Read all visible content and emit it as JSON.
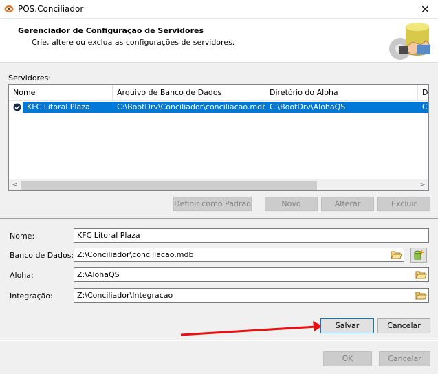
{
  "window": {
    "title": "POS.Conciliador",
    "close_glyph": "✕"
  },
  "header": {
    "title": "Gerenciador de Configuração de Servidores",
    "subtitle": "Crie, altere ou exclua as configurações de servidores.",
    "icon": "handshake-database-gear-icon"
  },
  "servers": {
    "label": "Servidores:",
    "columns": [
      "Nome",
      "Arquivo de Banco de Dados",
      "Diretório do Aloha",
      "Di"
    ],
    "rows": [
      {
        "cells": [
          "KFC Litoral Plaza",
          "C:\\BootDrv\\Conciliador\\conciliacao.mdb",
          "C:\\BootDrv\\AlohaQS",
          "C:"
        ],
        "selected": true,
        "default": true
      }
    ],
    "scroll_left": "<",
    "scroll_right": ">"
  },
  "list_buttons": {
    "set_default": "Definir como Padrão",
    "new": "Novo",
    "edit": "Alterar",
    "delete": "Excluir"
  },
  "form": {
    "name_label": "Nome:",
    "name_value": "KFC Litoral Plaza",
    "db_label": "Banco de Dados:",
    "db_value": "Z:\\Conciliador\\conciliacao.mdb",
    "aloha_label": "Aloha:",
    "aloha_value": "Z:\\AlohaQS",
    "integration_label": "Integração:",
    "integration_value": "Z:\\Conciliador\\Integracao"
  },
  "form_buttons": {
    "save": "Salvar",
    "cancel": "Cancelar"
  },
  "dialog_buttons": {
    "ok": "OK",
    "cancel": "Cancelar"
  },
  "annotation": {
    "arrow_color": "#e81010"
  },
  "colors": {
    "selection": "#0078d7",
    "accent": "#0078d7"
  }
}
